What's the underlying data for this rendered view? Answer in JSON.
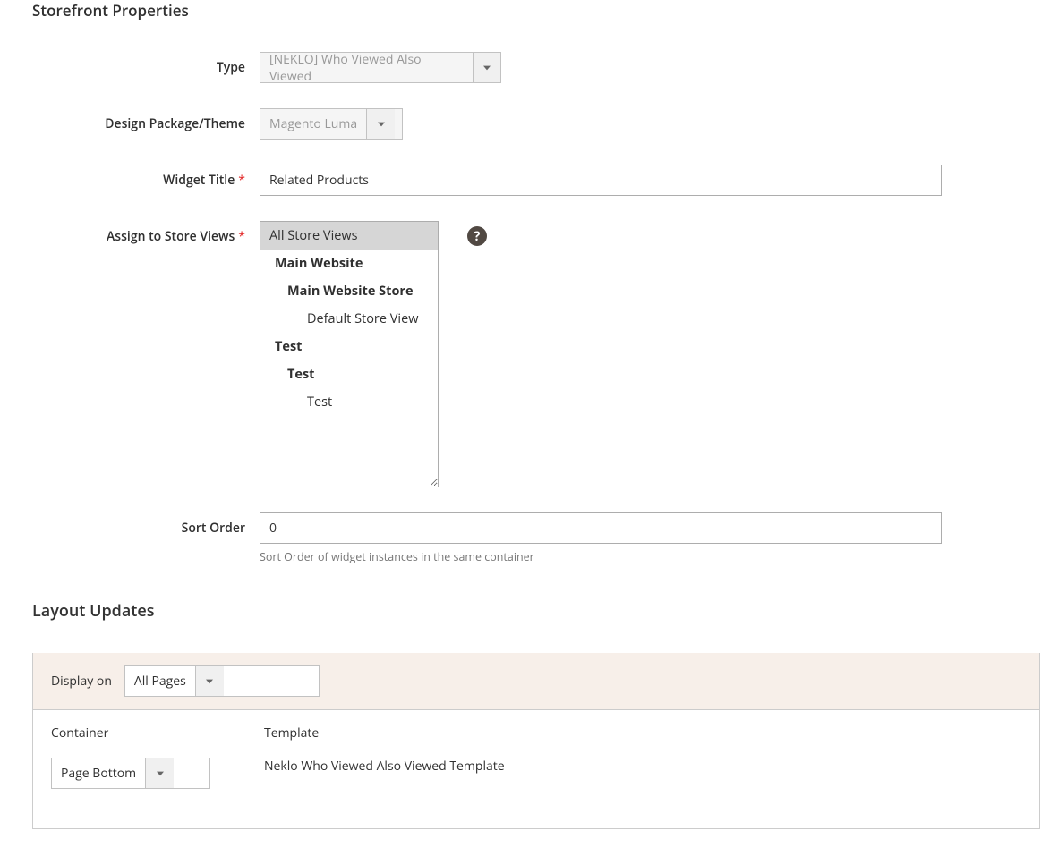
{
  "sections": {
    "storefront_title": "Storefront Properties",
    "layout_title": "Layout Updates"
  },
  "labels": {
    "type": "Type",
    "design": "Design Package/Theme",
    "widget_title": "Widget Title",
    "store_views": "Assign to Store Views",
    "sort_order": "Sort Order",
    "display_on": "Display on",
    "container": "Container",
    "template": "Template"
  },
  "values": {
    "type": "[NEKLO] Who Viewed Also Viewed",
    "design": "Magento Luma",
    "widget_title": "Related Products",
    "sort_order": "0",
    "display_on": "All Pages",
    "container": "Page Bottom",
    "template": "Neklo Who Viewed Also Viewed Template"
  },
  "store_views": [
    {
      "label": "All Store Views",
      "level": 0,
      "selected": true
    },
    {
      "label": "Main Website",
      "level": 1
    },
    {
      "label": "Main Website Store",
      "level": 2
    },
    {
      "label": "Default Store View",
      "level": 3
    },
    {
      "label": "Test",
      "level": 1
    },
    {
      "label": "Test",
      "level": 2
    },
    {
      "label": "Test",
      "level": 3
    }
  ],
  "hints": {
    "sort_order": "Sort Order of widget instances in the same container"
  },
  "help": "?"
}
